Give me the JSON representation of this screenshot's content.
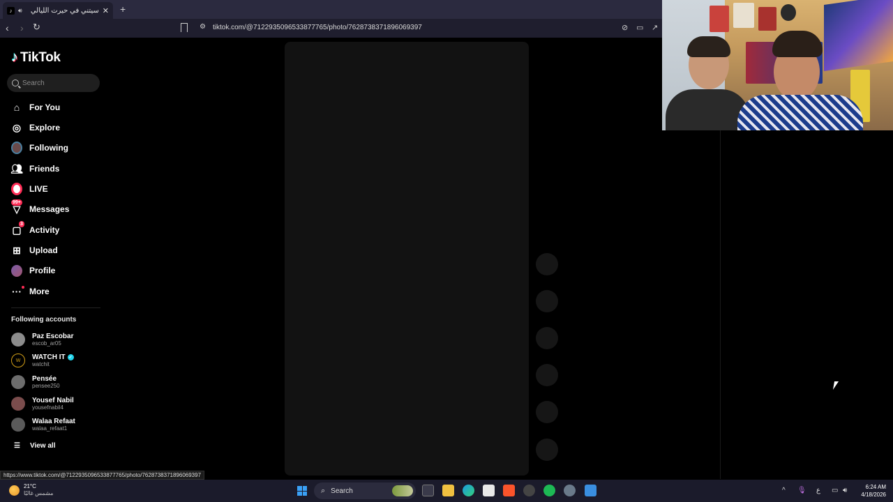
{
  "browser": {
    "tab_title": "سيتني في حيرت الليالي",
    "address": "tiktok.com/@7122935096533877765/photo/7628738371896069397",
    "status_url": "https://www.tiktok.com/@7122935096533877765/photo/7628738371896069397"
  },
  "sidebar": {
    "logo_text": "TikTok",
    "search_placeholder": "Search",
    "nav": [
      {
        "label": "For You",
        "icon": "home-icon"
      },
      {
        "label": "Explore",
        "icon": "compass-icon"
      },
      {
        "label": "Following",
        "icon": "following-avatar-icon"
      },
      {
        "label": "Friends",
        "icon": "friends-icon"
      },
      {
        "label": "LIVE",
        "icon": "live-icon"
      },
      {
        "label": "Messages",
        "icon": "messages-icon",
        "badge": "99+"
      },
      {
        "label": "Activity",
        "icon": "activity-icon",
        "badge": "3"
      },
      {
        "label": "Upload",
        "icon": "upload-icon"
      },
      {
        "label": "Profile",
        "icon": "profile-avatar-icon"
      },
      {
        "label": "More",
        "icon": "more-icon"
      }
    ],
    "following_title": "Following accounts",
    "accounts": [
      {
        "name": "Paz Escobar",
        "username": "escob_ar05",
        "color": "#8c8c8c"
      },
      {
        "name": "WATCH IT",
        "username": "watchit",
        "color": "#d4a017",
        "verified": true
      },
      {
        "name": "Pensée",
        "username": "pensee250",
        "color": "#6d6d6d"
      },
      {
        "name": "Yousef Nabil",
        "username": "yousefnabil4",
        "color": "#7a4c4c"
      },
      {
        "name": "Walaa Refaat",
        "username": "walaa_refaat1",
        "color": "#5a5a5a"
      }
    ],
    "view_all": "View all"
  },
  "taskbar": {
    "temperature": "21°C",
    "weather_desc": "مشمس غالبًا",
    "search_label": "Search",
    "time": "6:24 AM",
    "date": "4/18/2026",
    "ime": "ع"
  },
  "colors": {
    "accent": "#fe2c55",
    "cyan": "#25f4ee",
    "background": "#000000",
    "panel": "#121212"
  }
}
